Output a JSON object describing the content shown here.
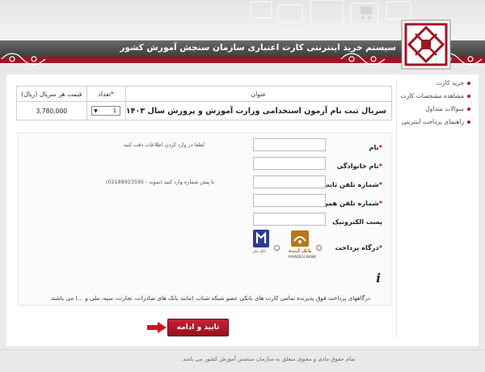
{
  "header": {
    "site_title": "سیستم خرید اینترنتی کارت اعتباری سازمان سنجش آموزش کشور"
  },
  "sidebar": {
    "items": [
      {
        "label": "خرید کارت"
      },
      {
        "label": "مشاهده مشخصات کارت"
      },
      {
        "label": "سوالات متداول"
      },
      {
        "label": "راهنمای پرداخت اینترنتی"
      }
    ]
  },
  "table": {
    "headers": {
      "title": "عنوان",
      "qty": "تعداد",
      "qty_marker": "*",
      "price": "قیمت هر سریال (ریال)"
    },
    "row": {
      "product": "سریال ثبت نام آزمون استخدامی وزارت آموزش و پرورش سال ۱۴۰۳",
      "qty": "1",
      "price": "3,780,000"
    }
  },
  "form": {
    "req_marker": "*",
    "name_label": "نام",
    "name_hint": "لطفا در وارد کردن اطلاعات دقت کنید",
    "family_label": "نام خانوادگی",
    "phone_label": "شماره تلفن ثابت",
    "phone_hint": "با پیش شماره وارد کنید (نمونه : 02188923595)",
    "mobile_label": "شماره تلفن همراه",
    "email_label": "پست الکترونیک",
    "gateway_label": "درگاه پرداخت",
    "banks": [
      {
        "name": "بانک آینده",
        "caption": "AYANDEH BANK"
      },
      {
        "name": "",
        "caption": "بانک ملی"
      }
    ]
  },
  "notice": "درگاههای پرداخت فوق پذیرنده تمامی کارت های بانکی عضو شبکه شتاب (مانند بانک های صادرات، تجارت، سپه، ملی و ...) می باشند",
  "submit_label": "تایید و ادامه",
  "footer": "تمام حقوق مادی و معنوی متعلق به سازمان سنجش آموزش کشور می باشد",
  "colors": {
    "brand_red": "#a01524",
    "title_bar": "#4a4a4a",
    "sidebar_dot": "#b0182a"
  }
}
